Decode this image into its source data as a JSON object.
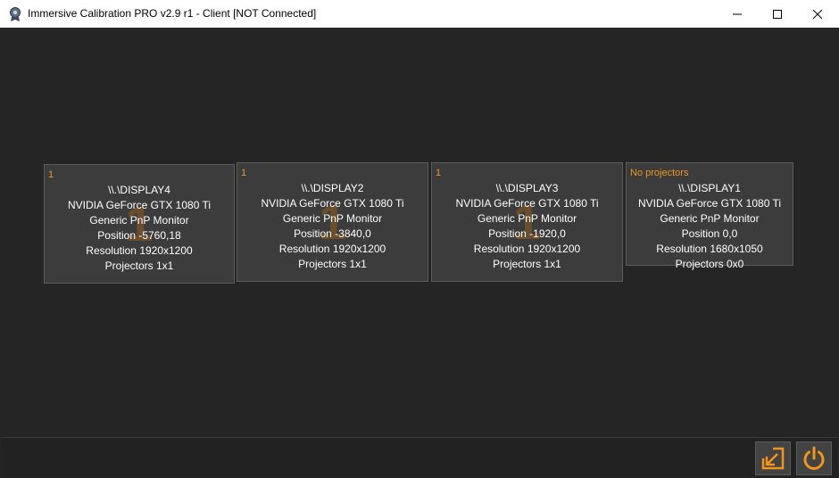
{
  "window": {
    "title": "Immersive Calibration PRO v2.9 r1 - Client [NOT Connected]"
  },
  "colors": {
    "accent": "#f0961e",
    "background": "#252525",
    "card": "#3c3c3c"
  },
  "displays": [
    {
      "tag": "1",
      "bg_number": "1",
      "name": "\\\\.\\DISPLAY4",
      "gpu": "NVIDIA GeForce GTX 1080 Ti",
      "monitor": "Generic PnP Monitor",
      "position": "Position -5760,18",
      "resolution": "Resolution 1920x1200",
      "projectors": "Projectors 1x1"
    },
    {
      "tag": "1",
      "bg_number": "1",
      "name": "\\\\.\\DISPLAY2",
      "gpu": "NVIDIA GeForce GTX 1080 Ti",
      "monitor": "Generic PnP Monitor",
      "position": "Position -3840,0",
      "resolution": "Resolution 1920x1200",
      "projectors": "Projectors 1x1"
    },
    {
      "tag": "1",
      "bg_number": "1",
      "name": "\\\\.\\DISPLAY3",
      "gpu": "NVIDIA GeForce GTX 1080 Ti",
      "monitor": "Generic PnP Monitor",
      "position": "Position -1920,0",
      "resolution": "Resolution 1920x1200",
      "projectors": "Projectors 1x1"
    },
    {
      "tag": "No projectors",
      "name": "\\\\.\\DISPLAY1",
      "gpu": "NVIDIA GeForce GTX 1080 Ti",
      "monitor": "Generic PnP Monitor",
      "position": "Position 0,0",
      "resolution": "Resolution 1680x1050",
      "projectors": "Projectors 0x0"
    }
  ],
  "toolbar": {
    "minimize_icon": "minimize-to-tray-icon",
    "power_icon": "power-icon"
  }
}
